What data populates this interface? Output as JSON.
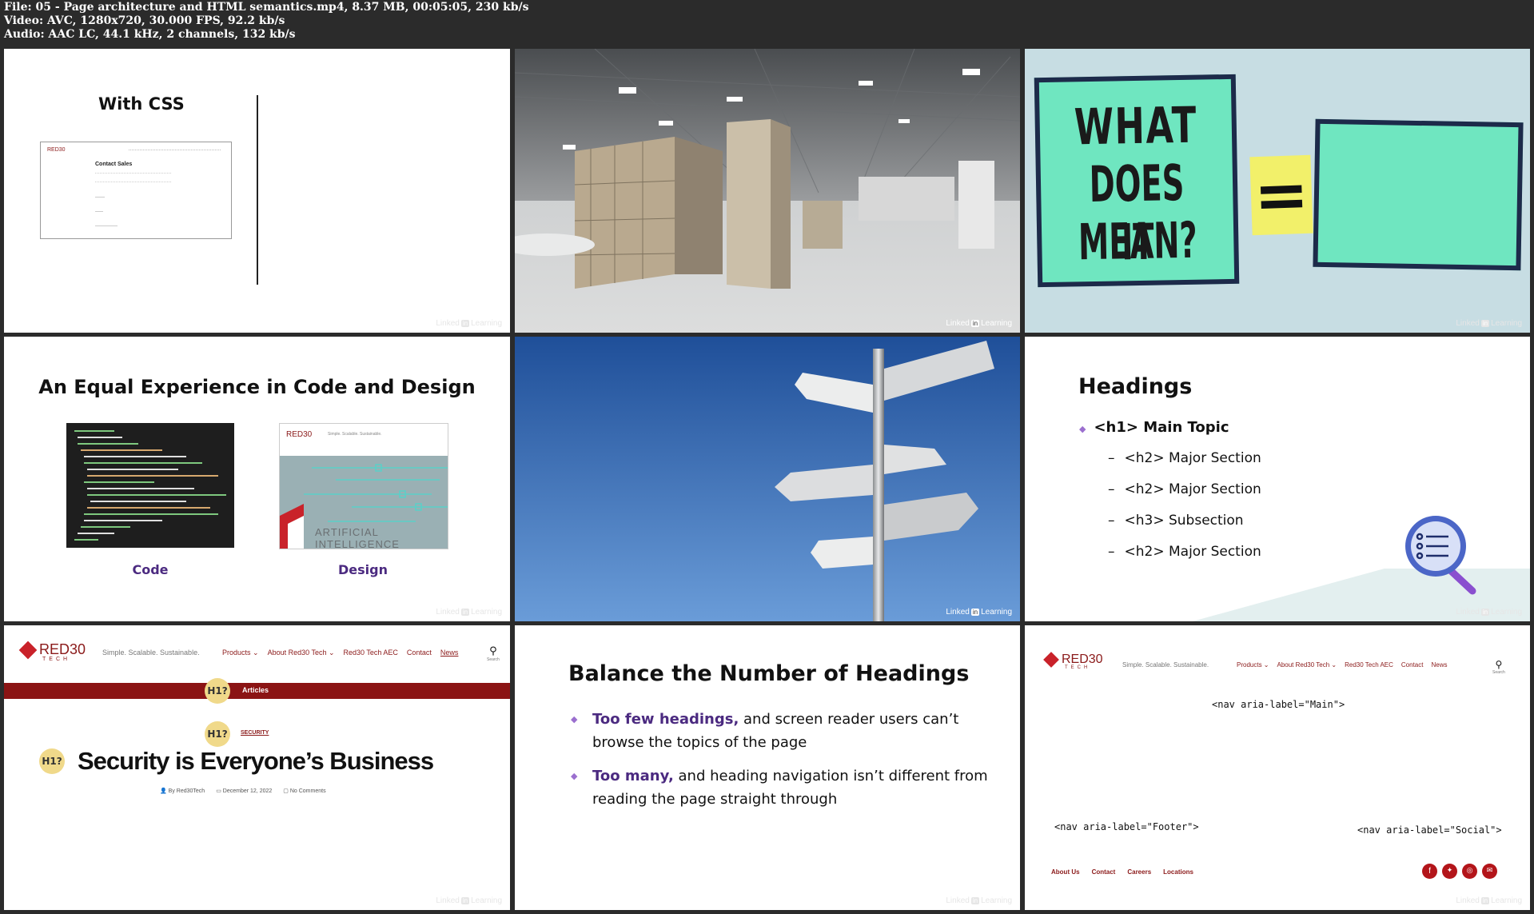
{
  "info": {
    "line1": "File: 05 - Page architecture and HTML semantics.mp4, 8.37 MB, 00:05:05, 230 kb/s",
    "line2": "Video: AVC, 1280x720, 30.000 FPS, 92.2 kb/s",
    "line3": "Audio: AAC LC, 44.1 kHz, 2 channels, 132 kb/s"
  },
  "watermark": {
    "brand": "Linked",
    "in": "in",
    "suffix": "Learning"
  },
  "t1": {
    "title": "With CSS",
    "mock_logo": "RED30",
    "mock_heading": "Contact Sales"
  },
  "t3": {
    "line1": "WHAT",
    "line2": "DOES IT",
    "line3": "MEAN?",
    "equals": "="
  },
  "t4": {
    "title": "An Equal Experience in Code and Design",
    "code_label": "Code",
    "design_label": "Design",
    "design_logo": "RED30",
    "design_tagline": "Simple. Scalable. Sustainable.",
    "design_ai": "ARTIFICIAL INTELLIGENCE"
  },
  "t6": {
    "title": "Headings",
    "items": [
      {
        "bullet": "◆",
        "text": "<h1> Main Topic"
      },
      {
        "bullet": "–",
        "text": "<h2> Major Section"
      },
      {
        "bullet": "–",
        "text": "<h2> Major Section"
      },
      {
        "bullet": "–",
        "text": "<h3> Subsection"
      },
      {
        "bullet": "–",
        "text": "<h2> Major Section"
      }
    ]
  },
  "t7": {
    "logo": "RED30",
    "logo_sub": "TECH",
    "tagline": "Simple. Scalable. Sustainable.",
    "nav": [
      "Products ⌄",
      "About Red30 Tech ⌄",
      "Red30 Tech AEC",
      "Contact",
      "News"
    ],
    "search": "Search",
    "badge": "H1?",
    "bar_label": "Articles",
    "category": "SECURITY",
    "headline": "Security is Everyone’s Business",
    "meta_author": "By Red30Tech",
    "meta_date": "December 12, 2022",
    "meta_comments": "No Comments"
  },
  "t8": {
    "title": "Balance the Number of Headings",
    "b1_strong": "Too few headings,",
    "b1_rest": " and screen reader users can’t browse the topics of the page",
    "b2_strong": "Too many,",
    "b2_rest": " and heading navigation isn’t different from reading the page straight through"
  },
  "t9": {
    "logo": "RED30",
    "logo_sub": "TECH",
    "tagline": "Simple. Scalable. Sustainable.",
    "nav": [
      "Products ⌄",
      "About Red30 Tech ⌄",
      "Red30 Tech AEC",
      "Contact",
      "News"
    ],
    "search": "Search",
    "nav_main": "<nav aria-label=\"Main\">",
    "nav_footer": "<nav aria-label=\"Footer\">",
    "nav_social": "<nav aria-label=\"Social\">",
    "footer_links": [
      "About Us",
      "Contact",
      "Careers",
      "Locations"
    ]
  },
  "colors": {
    "brand_red": "#8b1a1a",
    "purple": "#4b2a80",
    "bullet_purple": "#9b6fcf",
    "badge_yellow": "#f0d98a",
    "mint": "#6fe6c0"
  }
}
